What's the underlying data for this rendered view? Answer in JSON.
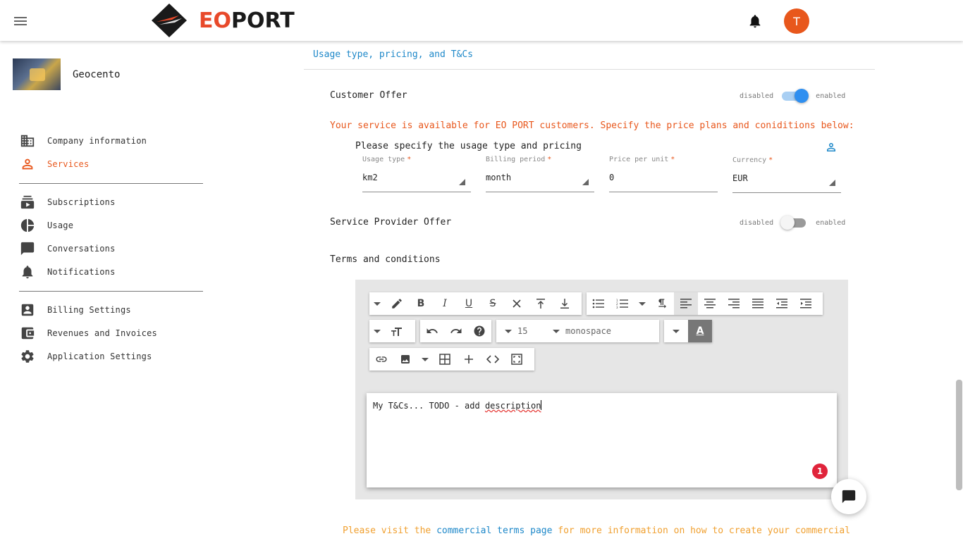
{
  "header": {
    "logo_eo": "EO",
    "logo_port": "PORT",
    "avatar_initial": "T",
    "icons": {
      "menu": "menu-icon",
      "notifications": "bell-icon"
    }
  },
  "sidebar": {
    "company_name": "Geocento",
    "items": [
      {
        "label": "Company information",
        "icon": "building-icon"
      },
      {
        "label": "Services",
        "icon": "person-outline-icon",
        "active": true
      },
      {
        "label": "Subscriptions",
        "icon": "subscriptions-icon"
      },
      {
        "label": "Usage",
        "icon": "pie-chart-icon"
      },
      {
        "label": "Conversations",
        "icon": "chat-bubble-icon"
      },
      {
        "label": "Notifications",
        "icon": "bell-icon"
      },
      {
        "label": "Billing Settings",
        "icon": "account-box-icon"
      },
      {
        "label": "Revenues and Invoices",
        "icon": "wallet-icon"
      },
      {
        "label": "Application Settings",
        "icon": "gear-icon"
      }
    ]
  },
  "main": {
    "section_title": "Usage type, pricing, and T&Cs",
    "customer_offer": {
      "label": "Customer Offer",
      "off_label": "disabled",
      "on_label": "enabled",
      "enabled": true
    },
    "warning": "Your service is available for EO PORT customers. Specify the price plans and coniditions below:",
    "pricing_heading": "Please specify the usage type and pricing",
    "fields": {
      "usage_type": {
        "label": "Usage type",
        "value": "km2",
        "required": "*"
      },
      "billing_period": {
        "label": "Billing period",
        "value": "month",
        "required": "*"
      },
      "price_per_unit": {
        "label": "Price per unit",
        "value": "0",
        "required": "*"
      },
      "currency": {
        "label": "Currency",
        "value": "EUR",
        "required": "*"
      }
    },
    "provider_offer": {
      "label": "Service Provider Offer",
      "off_label": "disabled",
      "on_label": "enabled",
      "enabled": false
    },
    "terms_label": "Terms and conditions",
    "editor": {
      "font_size": "15",
      "font_family": "monospace",
      "content_prefix": "My T&Cs... TODO - add ",
      "content_misspelled": "description",
      "badge_count": "1",
      "toolbar_icons": {
        "bold": "B",
        "italic": "I",
        "underline": "U",
        "strike": "S",
        "font_color": "A"
      }
    },
    "footer": {
      "text_before": "Please visit the ",
      "link": "commercial terms page",
      "text_after": " for more information on how to create your commercial"
    }
  },
  "colors": {
    "accent": "#e8571c",
    "link": "#1e88c9",
    "toggle_on": "#2f8ff0",
    "badge": "#e0243b"
  }
}
